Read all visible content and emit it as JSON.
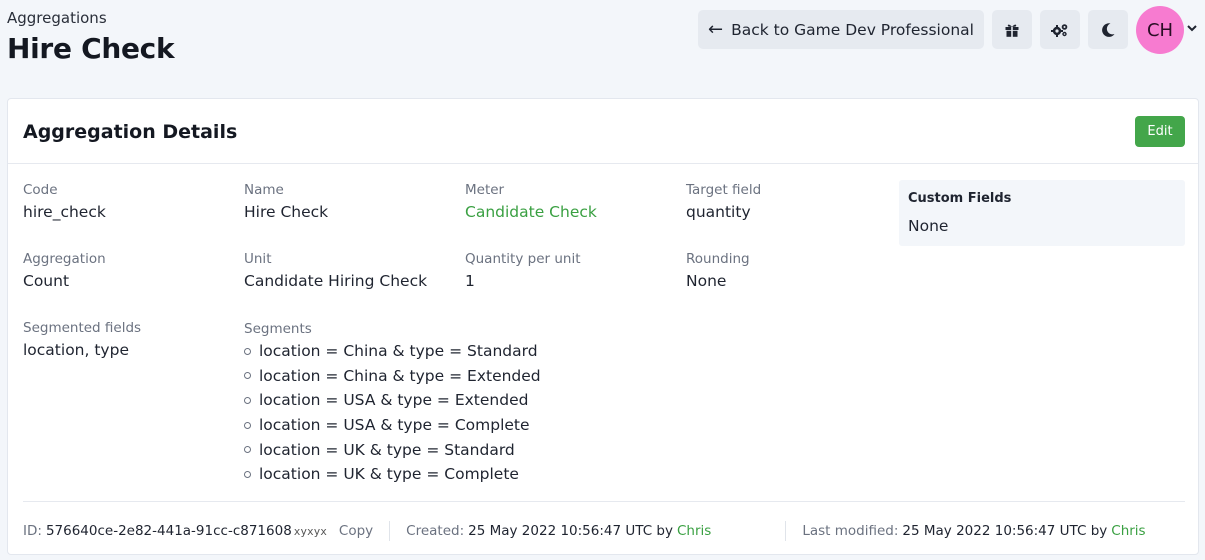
{
  "header": {
    "breadcrumb": "Aggregations",
    "title": "Hire Check",
    "back_label": "Back to Game Dev Professional",
    "avatar_initials": "CH",
    "icons": [
      "gift-icon",
      "gears-icon",
      "moon-icon",
      "chevron-down-icon"
    ]
  },
  "card": {
    "title": "Aggregation Details",
    "edit_label": "Edit",
    "fields": {
      "code": {
        "label": "Code",
        "value": "hire_check"
      },
      "name": {
        "label": "Name",
        "value": "Hire Check"
      },
      "meter": {
        "label": "Meter",
        "value": "Candidate Check"
      },
      "target_field": {
        "label": "Target field",
        "value": "quantity"
      },
      "aggregation": {
        "label": "Aggregation",
        "value": "Count"
      },
      "unit": {
        "label": "Unit",
        "value": "Candidate Hiring Check"
      },
      "quantity_per_unit": {
        "label": "Quantity per unit",
        "value": "1"
      },
      "rounding": {
        "label": "Rounding",
        "value": "None"
      },
      "segmented_fields": {
        "label": "Segmented fields",
        "value": "location, type"
      }
    },
    "segments": {
      "label": "Segments",
      "items": [
        "location = China & type = Standard",
        "location = China & type = Extended",
        "location = USA & type = Extended",
        "location = USA & type = Complete",
        "location = UK & type = Standard",
        "location = UK & type = Complete"
      ]
    },
    "custom_fields": {
      "title": "Custom Fields",
      "value": "None"
    }
  },
  "footer": {
    "id_label": "ID:",
    "id_value": "576640ce-2e82-441a-91cc-c871608",
    "id_masked": "xyxyx",
    "copy_label": "Copy",
    "created_label": "Created:",
    "created_value": "25 May 2022 10:56:47 UTC by",
    "created_by": "Chris",
    "modified_label": "Last modified:",
    "modified_value": "25 May 2022 10:56:47 UTC by",
    "modified_by": "Chris"
  },
  "colors": {
    "accent": "#43a64a",
    "avatar": "#f77bd0",
    "link": "#3aa042"
  }
}
